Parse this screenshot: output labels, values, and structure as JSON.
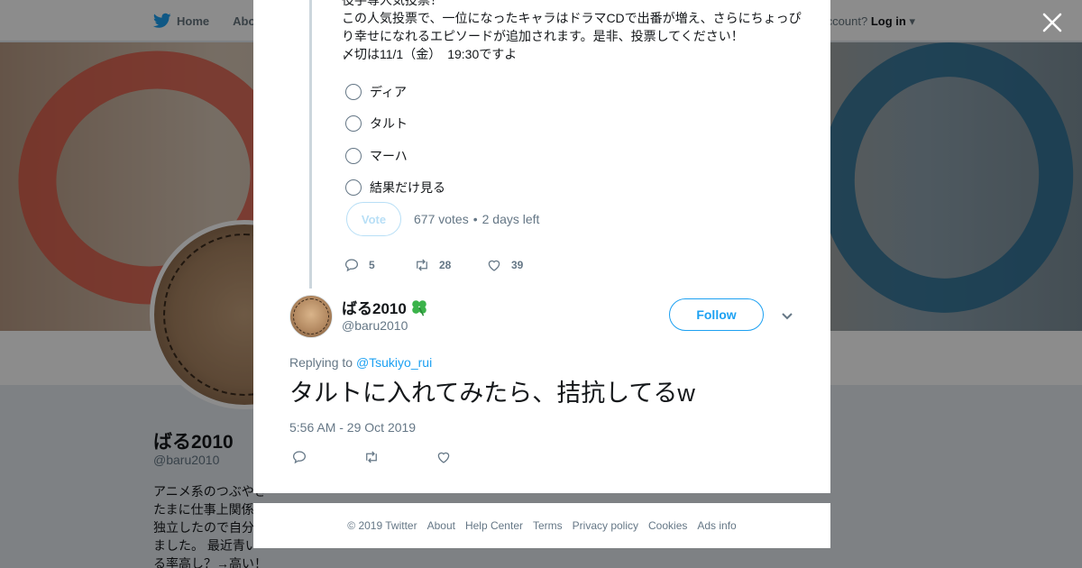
{
  "topbar": {
    "home_label": "Home",
    "about_label": "Abo",
    "account_prompt": "ccount?",
    "login_label": "Log in"
  },
  "profile": {
    "name": "ばる2010",
    "handle": "@baru2010",
    "bio": "アニメ系のつぶやき\nたまに仕事上関係\n独立したので自分\nました。 最近青い\nる率高し？→高い！"
  },
  "poll_tweet": {
    "text": "役手専人気投票！\nこの人気投票で、一位になったキャラはドラマCDで出番が増え、さらにちょっぴり幸せになれるエピソードが追加されます。是非、投票してください！\n〆切は11/1（金）　19:30ですよ",
    "options": [
      "ディア",
      "タルト",
      "マーハ",
      "結果だけ見る"
    ],
    "vote_label": "Vote",
    "votes": "677 votes",
    "separator": "•",
    "time_left": "2 days left",
    "reply_count": "5",
    "retweet_count": "28",
    "like_count": "39"
  },
  "reply_tweet": {
    "name": "ばる2010",
    "handle": "@baru2010",
    "follow_label": "Follow",
    "replying_prefix": "Replying to",
    "replying_to": "@Tsukiyo_rui",
    "text": "タルトに入れてみたら、拮抗してるw",
    "timestamp": "5:56 AM - 29 Oct 2019"
  },
  "footer": {
    "copyright": "© 2019 Twitter",
    "links": [
      "About",
      "Help Center",
      "Terms",
      "Privacy policy",
      "Cookies",
      "Ads info"
    ]
  },
  "colors": {
    "accent": "#1da1f2",
    "muted": "#657786",
    "clover": "#3bb34a"
  },
  "icons": [
    "twitter-bird-icon",
    "home-icon",
    "close-icon",
    "reply-icon",
    "retweet-icon",
    "like-icon",
    "chevron-down-icon",
    "clover-emoji-icon"
  ]
}
